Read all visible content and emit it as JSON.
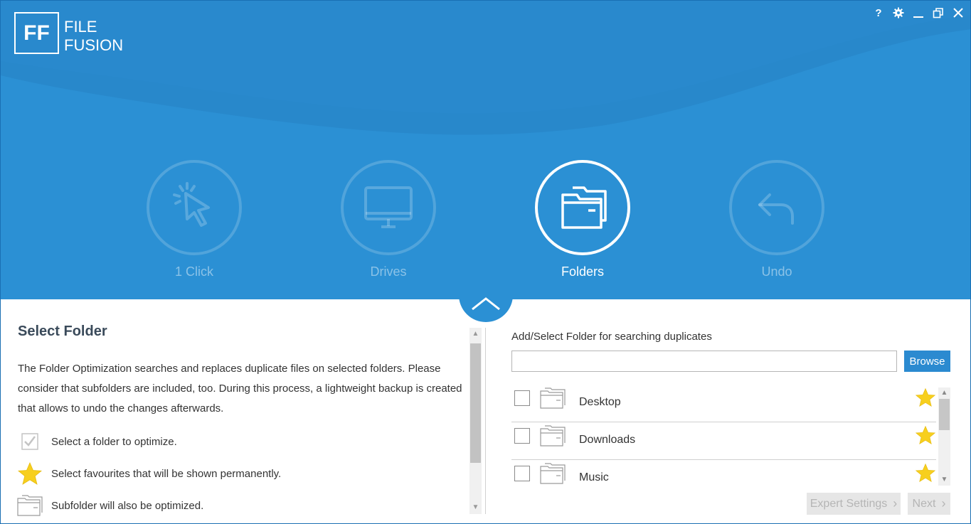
{
  "app": {
    "logo_mark": "FF",
    "logo_line1": "FILE",
    "logo_line2": "FUSION"
  },
  "window_controls": {
    "help_label": "?",
    "icons": [
      "help-icon",
      "gear-icon",
      "minimize-icon",
      "restore-icon",
      "close-icon"
    ]
  },
  "modes": [
    {
      "label": "1 Click",
      "icon": "cursor-click-icon",
      "active": false
    },
    {
      "label": "Drives",
      "icon": "monitor-icon",
      "active": false
    },
    {
      "label": "Folders",
      "icon": "folders-icon",
      "active": true
    },
    {
      "label": "Undo",
      "icon": "undo-arrow-icon",
      "active": false
    }
  ],
  "left_panel": {
    "title": "Select Folder",
    "description": "The Folder Optimization searches and replaces duplicate files on selected folders. Please consider that subfolders are included, too. During this process, a lightweight backup is created that allows to undo the changes afterwards.",
    "legend": [
      {
        "icon": "checkbox-checked-icon",
        "text": "Select a folder to optimize."
      },
      {
        "icon": "star-icon",
        "text": "Select favourites that will be shown permanently."
      },
      {
        "icon": "folder-icon",
        "text": "Subfolder will also be optimized."
      }
    ]
  },
  "right_panel": {
    "title": "Add/Select Folder for searching duplicates",
    "path_value": "",
    "browse_label": "Browse",
    "folders": [
      {
        "name": "Desktop",
        "checked": false,
        "favourite": true
      },
      {
        "name": "Downloads",
        "checked": false,
        "favourite": true
      },
      {
        "name": "Music",
        "checked": false,
        "favourite": true
      }
    ]
  },
  "footer": {
    "expert_settings_label": "Expert Settings",
    "next_label": "Next"
  },
  "colors": {
    "header_blue": "#2b90d4",
    "button_blue": "#2b8ad0",
    "star_yellow": "#f7cf1e"
  }
}
